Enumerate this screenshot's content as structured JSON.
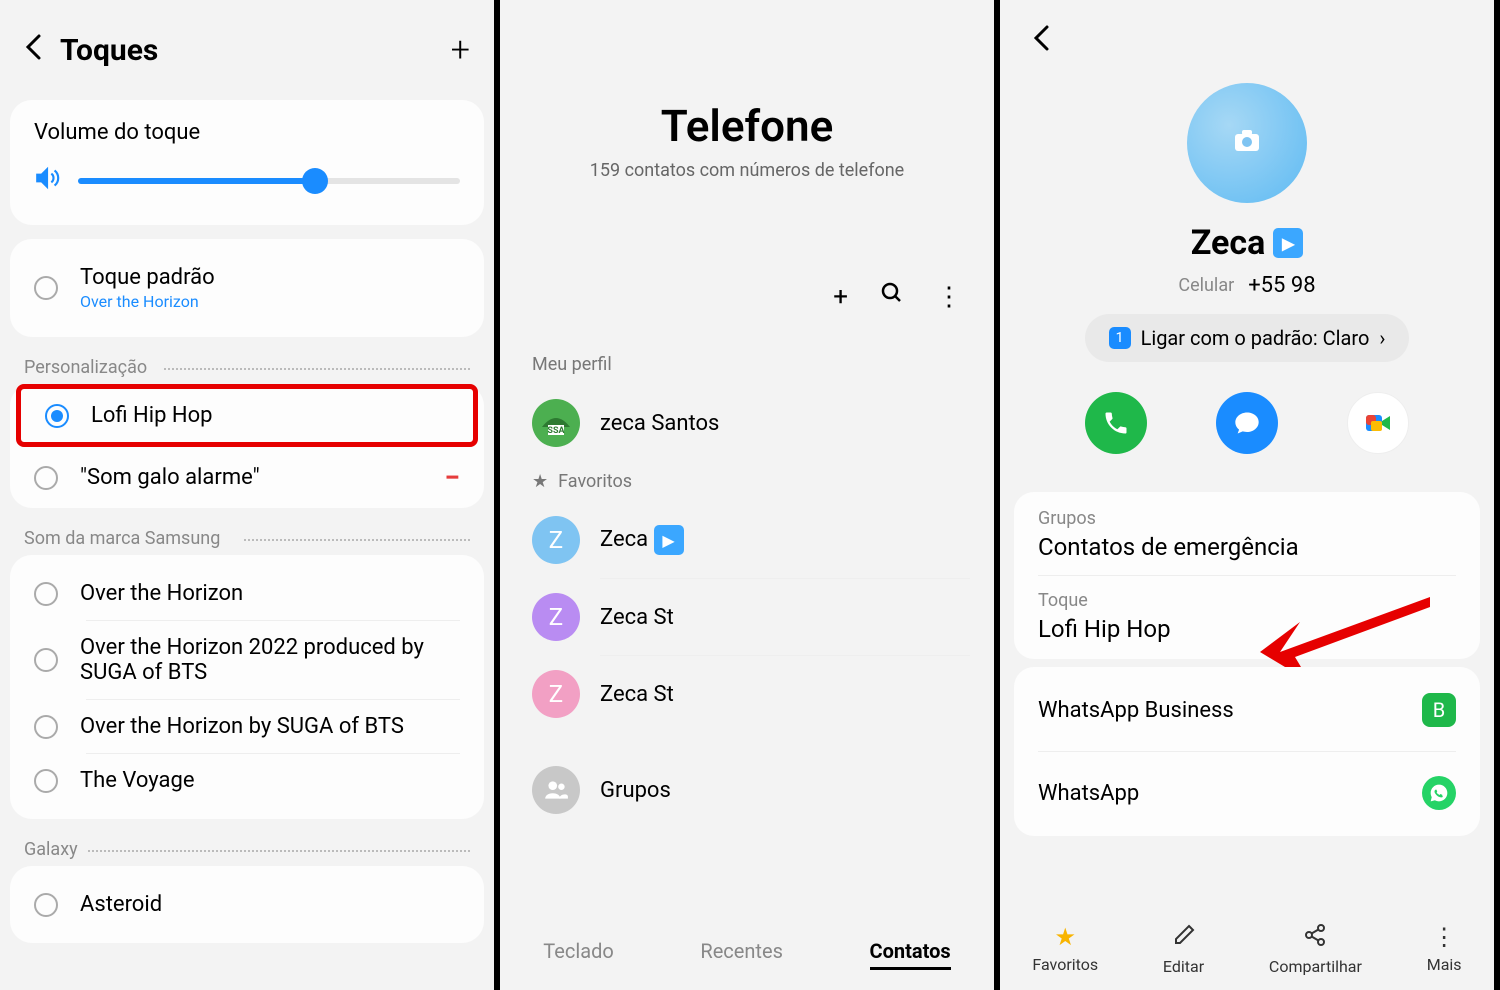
{
  "panel1": {
    "title": "Toques",
    "volume_title": "Volume do toque",
    "default_ring": {
      "label": "Toque padrão",
      "sub": "Over the Horizon"
    },
    "section_personalization": "Personalização",
    "lofi": "Lofi Hip Hop",
    "galo": "\"Som galo alarme\"",
    "section_samsung": "Som da marca Samsung",
    "samsung_items": [
      "Over the Horizon",
      "Over the Horizon 2022 produced by SUGA of BTS",
      "Over the Horizon by SUGA of BTS",
      "The Voyage"
    ],
    "section_galaxy": "Galaxy",
    "galaxy_items": [
      "Asteroid"
    ]
  },
  "panel2": {
    "title": "Telefone",
    "subtitle": "159 contatos com números de telefone",
    "section_profile": "Meu perfil",
    "profile_name": "zeca Santos",
    "section_favorites": "Favoritos",
    "favorites": [
      {
        "initial": "Z",
        "name": "Zeca",
        "play": true,
        "color": "#7fc4f2"
      },
      {
        "initial": "Z",
        "name": "Zeca St",
        "play": false,
        "color": "#b98cf2"
      },
      {
        "initial": "Z",
        "name": "Zeca St",
        "play": false,
        "color": "#f2a0c4"
      }
    ],
    "groups": "Grupos",
    "tabs": {
      "keyboard": "Teclado",
      "recent": "Recentes",
      "contacts": "Contatos"
    }
  },
  "panel3": {
    "name": "Zeca",
    "phone_label": "Celular",
    "phone": "+55 98",
    "call_chip": "Ligar com o padrão: Claro",
    "groups_label": "Grupos",
    "groups_value": "Contatos de emergência",
    "tone_label": "Toque",
    "tone_value": "Lofi Hip Hop",
    "wa_business": "WhatsApp Business",
    "wa": "WhatsApp",
    "tabs": {
      "fav": "Favoritos",
      "edit": "Editar",
      "share": "Compartilhar",
      "more": "Mais"
    }
  }
}
